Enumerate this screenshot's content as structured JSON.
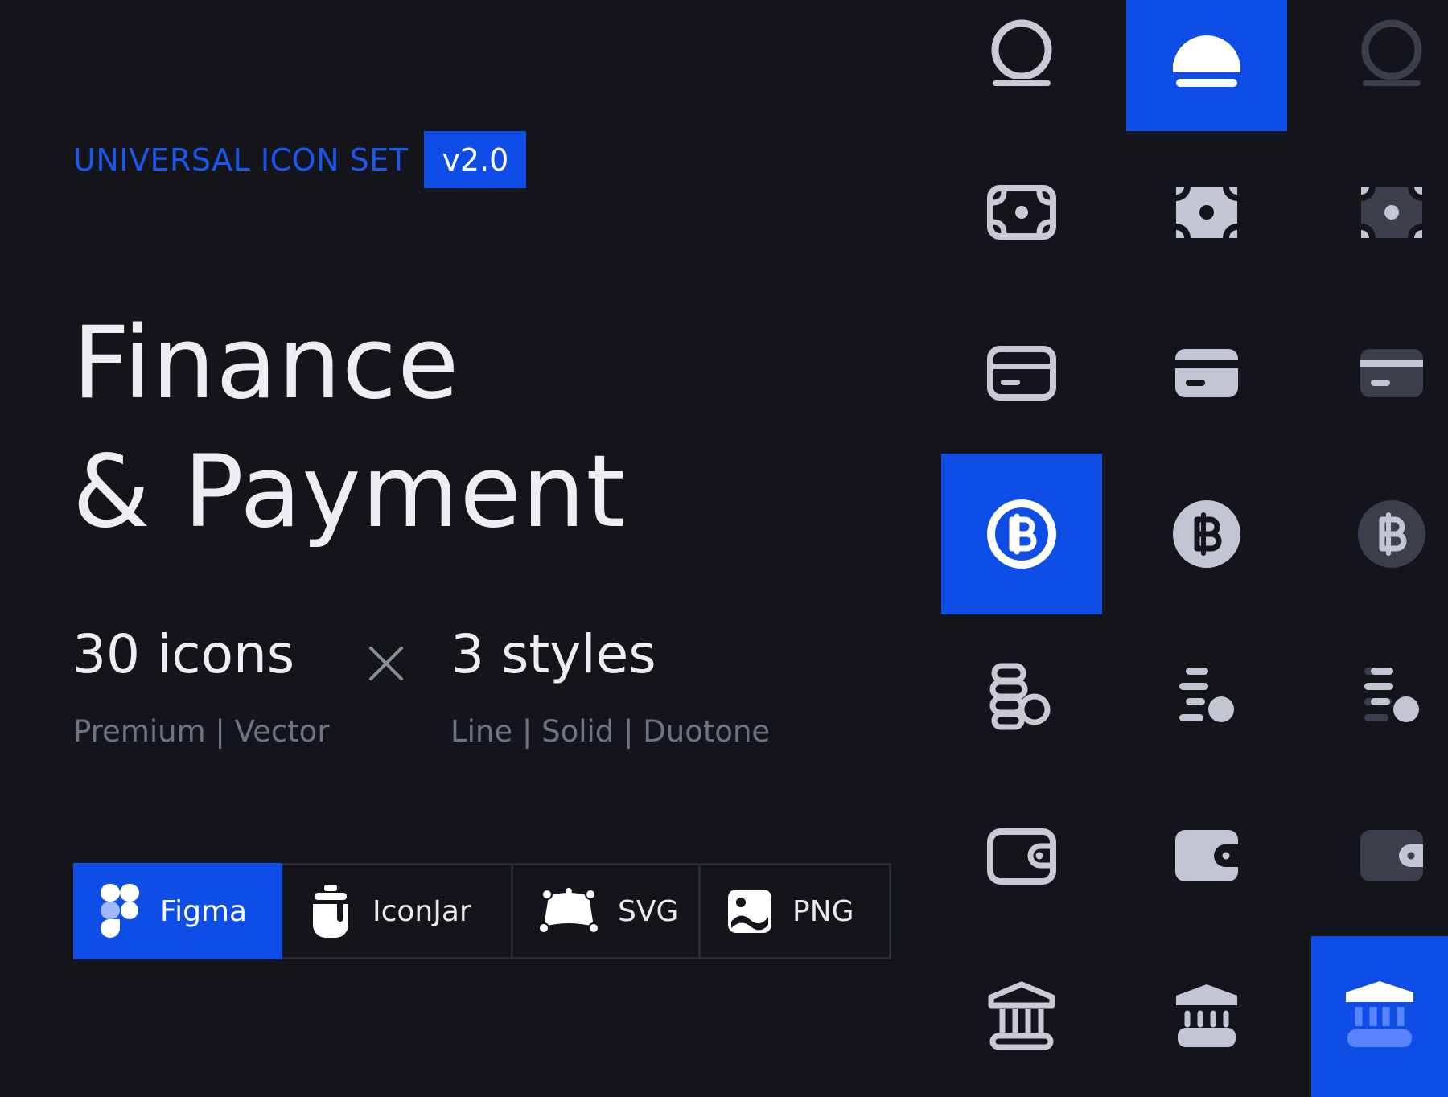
{
  "header": {
    "brand": "UNIVERSAL ICON SET",
    "version": "v2.0"
  },
  "title": {
    "line1": "Finance",
    "line2": "& Payment"
  },
  "stats": {
    "icon_count": "30 icons",
    "multiply_symbol": "×",
    "style_count": "3 styles",
    "icon_count_caption": "Premium | Vector",
    "style_count_caption": "Line | Solid | Duotone"
  },
  "formats": [
    {
      "label": "Figma",
      "icon": "figma-logo-icon",
      "active": true
    },
    {
      "label": "IconJar",
      "icon": "iconjar-jar-icon",
      "active": false
    },
    {
      "label": "SVG",
      "icon": "svg-vector-icon",
      "active": false
    },
    {
      "label": "PNG",
      "icon": "png-image-icon",
      "active": false
    }
  ],
  "icon_grid": {
    "columns": [
      "line",
      "solid",
      "duotone"
    ],
    "rows": [
      {
        "name": "sunset-coin",
        "icons": [
          "sunset-line-icon",
          "sunset-solid-icon",
          "sunset-duotone-icon"
        ]
      },
      {
        "name": "banknote",
        "icons": [
          "banknote-line-icon",
          "banknote-solid-icon",
          "banknote-duotone-icon"
        ]
      },
      {
        "name": "credit-card",
        "icons": [
          "credit-card-line-icon",
          "credit-card-solid-icon",
          "credit-card-duotone-icon"
        ]
      },
      {
        "name": "bitcoin",
        "icons": [
          "bitcoin-line-icon",
          "bitcoin-solid-icon",
          "bitcoin-duotone-icon"
        ]
      },
      {
        "name": "coins-stack",
        "icons": [
          "coins-stack-line-icon",
          "coins-stack-solid-icon",
          "coins-stack-duotone-icon"
        ]
      },
      {
        "name": "wallet",
        "icons": [
          "wallet-line-icon",
          "wallet-solid-icon",
          "wallet-duotone-icon"
        ]
      },
      {
        "name": "bank",
        "icons": [
          "bank-line-icon",
          "bank-solid-icon",
          "bank-duotone-icon"
        ]
      }
    ],
    "highlighted": [
      "sunset-solid-icon",
      "bitcoin-line-icon",
      "bank-duotone-icon"
    ]
  },
  "colors": {
    "background": "#14151b",
    "accent": "#0f4ee6",
    "text": "#eceef3",
    "muted_text": "#6f7482",
    "icon_line": "#c9cad3",
    "icon_solid": "#c3c5d2",
    "icon_duotone_dark": "#3c3e4a"
  }
}
